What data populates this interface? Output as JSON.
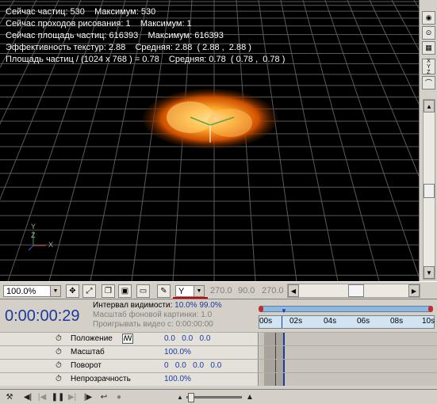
{
  "stats": {
    "line1": "Сейчас частиц: 530    Максимум: 530",
    "line2": "Сейчас проходов рисования: 1    Максимум: 1",
    "line3": "Сейчас площадь частиц: 616393    Максимум: 616393",
    "line4": "Эффективность текстур: 2.88    Средняя: 2.88  ( 2.88 ,  2.88 )",
    "line5": "Площадь частиц / (1024 x 768 ) = 0.78    Средняя: 0.78  ( 0.78 ,  0.78 )"
  },
  "axes": {
    "y": "Y",
    "z": "Z",
    "x": "X"
  },
  "viewtools": {
    "zoom": "100.0%",
    "axis_select": "Y",
    "rot1": "270.0",
    "rot2": "90.0",
    "rot3": "270.0"
  },
  "timeline": {
    "timecode": "0:00:00:29",
    "interval_label": "Интервал видимости:",
    "interval_start": "10.0%",
    "interval_end": "99.0%",
    "bg_scale": "Масштаб фоновой картинки: 1.0",
    "play_video": "Проигрывать видео с: 0:00:00:00",
    "ticks": [
      "00s",
      "02s",
      "04s",
      "06s",
      "08s",
      "10s"
    ]
  },
  "rows": [
    {
      "name": "Положение",
      "values": "0.0   0.0   0.0"
    },
    {
      "name": "Масштаб",
      "values": "100.0%"
    },
    {
      "name": "Поворот",
      "values": "0   0.0   0.0   0.0"
    },
    {
      "name": "Непрозрачность",
      "values": "100.0%"
    }
  ],
  "colors": {
    "accent": "#1a3aa0",
    "highlight": "#d00000",
    "ruler": "#d0e4f4"
  }
}
